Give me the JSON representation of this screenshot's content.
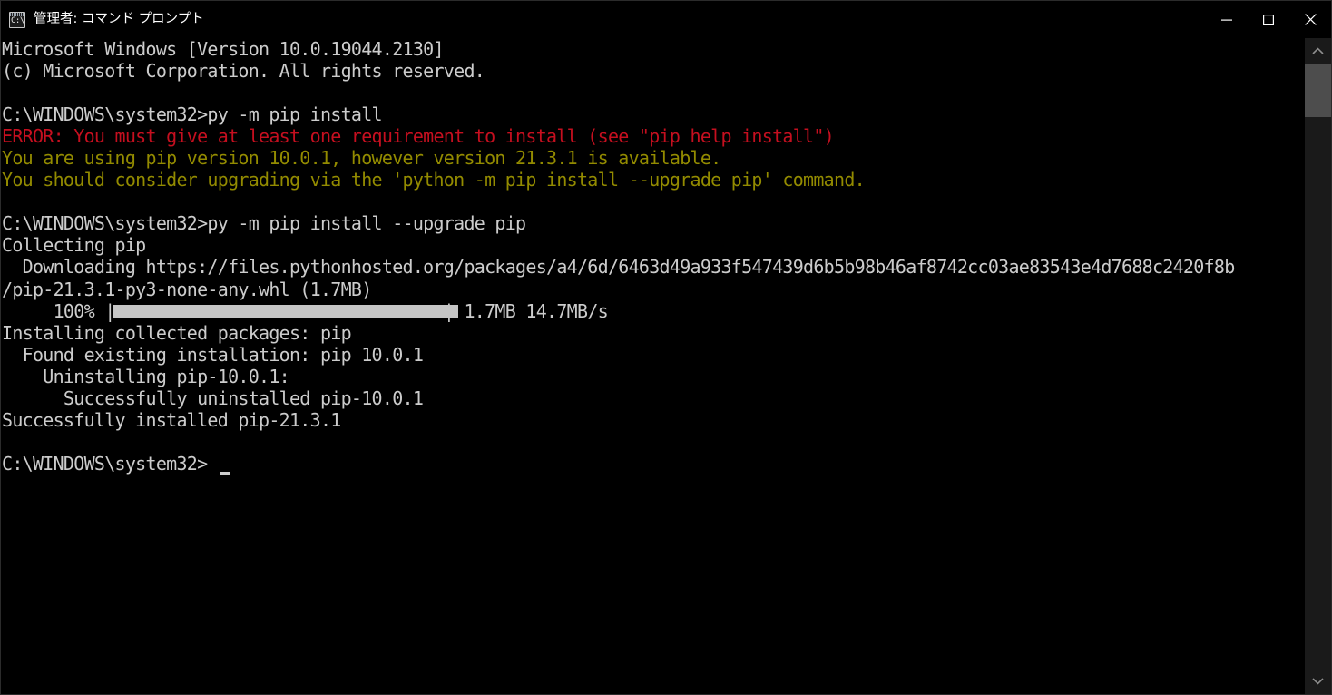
{
  "window": {
    "title": "管理者: コマンド プロンプト",
    "icon": "cmd-prompt-icon",
    "icon_glyph": "C:\\_",
    "background_color": "#000000",
    "text_color": "#cccccc",
    "error_color": "#c50f1f",
    "warning_color": "#938b00"
  },
  "window_controls": {
    "minimize_label": "最小化",
    "maximize_label": "最大化",
    "close_label": "閉じる"
  },
  "scrollbar": {
    "up_label": "上にスクロール",
    "down_label": "下にスクロール",
    "thumb_label": "スクロール バー"
  },
  "console": {
    "lines": [
      {
        "text": "Microsoft Windows [Version 10.0.19044.2130]",
        "style": "normal"
      },
      {
        "text": "(c) Microsoft Corporation. All rights reserved.",
        "style": "normal"
      },
      {
        "text": "",
        "style": "normal"
      },
      {
        "text": "C:\\WINDOWS\\system32>py -m pip install",
        "style": "normal"
      },
      {
        "text": "ERROR: You must give at least one requirement to install (see \"pip help install\")",
        "style": "error"
      },
      {
        "text": "You are using pip version 10.0.1, however version 21.3.1 is available.",
        "style": "warning"
      },
      {
        "text": "You should consider upgrading via the 'python -m pip install --upgrade pip' command.",
        "style": "warning"
      },
      {
        "text": "",
        "style": "normal"
      },
      {
        "text": "C:\\WINDOWS\\system32>py -m pip install --upgrade pip",
        "style": "normal"
      },
      {
        "text": "Collecting pip",
        "style": "normal"
      },
      {
        "text": "  Downloading https://files.pythonhosted.org/packages/a4/6d/6463d49a933f547439d6b5b98b46af8742cc03ae83543e4d7688c2420f8b",
        "style": "normal"
      },
      {
        "text": "/pip-21.3.1-py3-none-any.whl (1.7MB)",
        "style": "normal"
      },
      {
        "text": "PROGRESS_BAR_LINE",
        "style": "progress"
      },
      {
        "text": "Installing collected packages: pip",
        "style": "normal"
      },
      {
        "text": "  Found existing installation: pip 10.0.1",
        "style": "normal"
      },
      {
        "text": "    Uninstalling pip-10.0.1:",
        "style": "normal"
      },
      {
        "text": "      Successfully uninstalled pip-10.0.1",
        "style": "normal"
      },
      {
        "text": "Successfully installed pip-21.3.1",
        "style": "normal"
      },
      {
        "text": "",
        "style": "normal"
      },
      {
        "text": "C:\\WINDOWS\\system32>",
        "style": "normal"
      }
    ],
    "progress": {
      "percent_label": "100%",
      "percent_value": 100,
      "bar_open": "|",
      "bar_close": "|",
      "size_label": "1.7MB",
      "speed_label": "14.7MB/s",
      "full_line": "    100% |████████████████████████████████| 1.7MB 14.7MB/s"
    },
    "prompt_path": "C:\\WINDOWS\\system32>",
    "cursor_visible": true
  }
}
